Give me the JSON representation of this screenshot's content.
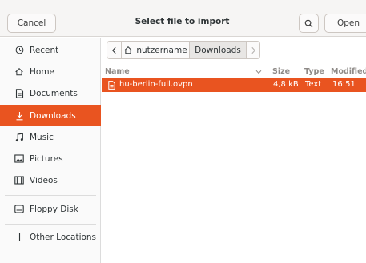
{
  "header": {
    "title": "Select file to import",
    "cancel_label": "Cancel",
    "open_label": "Open"
  },
  "sidebar": {
    "items": [
      {
        "label": "Recent",
        "icon": "clock-icon"
      },
      {
        "label": "Home",
        "icon": "home-icon"
      },
      {
        "label": "Documents",
        "icon": "document-icon"
      },
      {
        "label": "Downloads",
        "icon": "download-icon",
        "active": true
      },
      {
        "label": "Music",
        "icon": "music-icon"
      },
      {
        "label": "Pictures",
        "icon": "picture-icon"
      },
      {
        "label": "Videos",
        "icon": "video-icon"
      },
      {
        "label": "Floppy Disk",
        "icon": "drive-icon"
      },
      {
        "label": "Other Locations",
        "icon": "plus-icon"
      }
    ]
  },
  "pathbar": {
    "home_label": "nutzername",
    "current_label": "Downloads"
  },
  "list": {
    "columns": {
      "name": "Name",
      "size": "Size",
      "type": "Type",
      "modified": "Modified"
    },
    "rows": [
      {
        "name": "hu-berlin-full.ovpn",
        "size": "4,8 kB",
        "type": "Text",
        "modified": "16:51",
        "selected": true
      }
    ]
  },
  "colors": {
    "accent": "#e95420",
    "header_bg": "#f6f5f4",
    "sidebar_bg": "#fafafa"
  }
}
